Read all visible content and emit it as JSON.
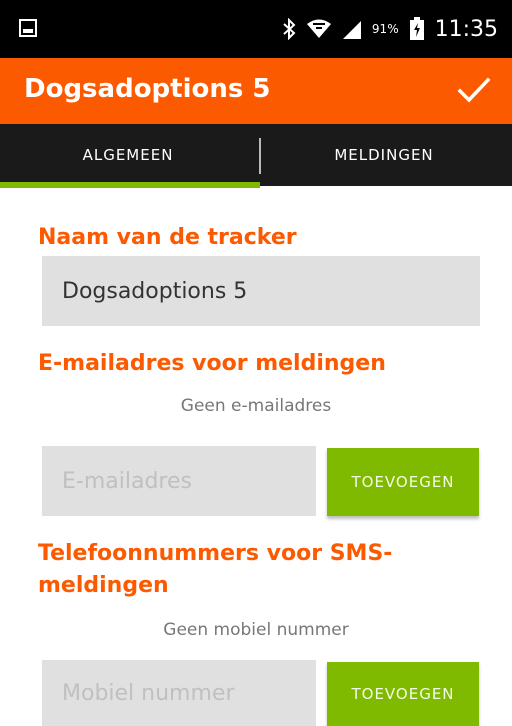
{
  "status_bar": {
    "battery_percent": "91%",
    "time": "11:35",
    "icons": [
      "screenshot-icon",
      "bluetooth-icon",
      "wifi-icon",
      "signal-icon",
      "battery-icon"
    ]
  },
  "app_bar": {
    "title": "Dogsadoptions 5",
    "confirm_icon": "checkmark-icon",
    "color": "#fb5a00"
  },
  "tabs": [
    {
      "label": "ALGEMEEN",
      "active": true
    },
    {
      "label": "MELDINGEN",
      "active": false
    }
  ],
  "tracker_name": {
    "title": "Naam van de tracker",
    "value": "Dogsadoptions 5"
  },
  "email": {
    "title": "E-mailadres voor meldingen",
    "empty_note": "Geen e-mailadres",
    "placeholder": "E-mailadres",
    "button_label": "TOEVOEGEN"
  },
  "sms": {
    "title_line1": "Telefoonnummers voor SMS-",
    "title_line2": "meldingen",
    "empty_note": "Geen mobiel nummer",
    "placeholder": "Mobiel nummer",
    "button_label": "TOEVOEGEN"
  },
  "colors": {
    "accent_orange": "#fb5a00",
    "accent_green": "#7fba00",
    "tab_background": "#1a1a1a"
  }
}
